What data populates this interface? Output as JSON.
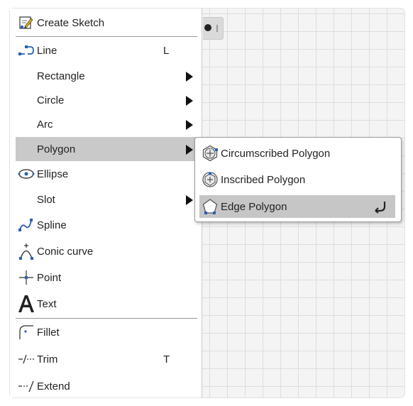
{
  "menu": {
    "header": {
      "label": "Create Sketch",
      "icon": "create-sketch-icon"
    },
    "items": [
      {
        "label": "Line",
        "shortcut": "L",
        "icon": "line-icon",
        "submenu": false
      },
      {
        "label": "Rectangle",
        "shortcut": "",
        "icon": "",
        "submenu": true
      },
      {
        "label": "Circle",
        "shortcut": "",
        "icon": "",
        "submenu": true
      },
      {
        "label": "Arc",
        "shortcut": "",
        "icon": "",
        "submenu": true
      },
      {
        "label": "Polygon",
        "shortcut": "",
        "icon": "",
        "submenu": true,
        "highlighted": true
      },
      {
        "label": "Ellipse",
        "shortcut": "",
        "icon": "ellipse-icon",
        "submenu": false
      },
      {
        "label": "Slot",
        "shortcut": "",
        "icon": "",
        "submenu": true
      },
      {
        "label": "Spline",
        "shortcut": "",
        "icon": "spline-icon",
        "submenu": false
      },
      {
        "label": "Conic curve",
        "shortcut": "",
        "icon": "conic-curve-icon",
        "submenu": false
      },
      {
        "label": "Point",
        "shortcut": "",
        "icon": "point-icon",
        "submenu": false
      },
      {
        "label": "Text",
        "shortcut": "",
        "icon": "text-icon",
        "submenu": false
      },
      {
        "label": "Fillet",
        "shortcut": "",
        "icon": "fillet-icon",
        "submenu": false
      },
      {
        "label": "Trim",
        "shortcut": "T",
        "icon": "trim-icon",
        "submenu": false
      },
      {
        "label": "Extend",
        "shortcut": "",
        "icon": "extend-icon",
        "submenu": false
      }
    ]
  },
  "submenu": {
    "items": [
      {
        "label": "Circumscribed Polygon",
        "icon": "circumscribed-polygon-icon"
      },
      {
        "label": "Inscribed Polygon",
        "icon": "inscribed-polygon-icon"
      },
      {
        "label": "Edge Polygon",
        "icon": "edge-polygon-icon",
        "highlighted": true
      }
    ]
  },
  "colors": {
    "highlight": "#c9c9c9",
    "icon_blue": "#2a5fb4",
    "grid": "#dddddd"
  }
}
